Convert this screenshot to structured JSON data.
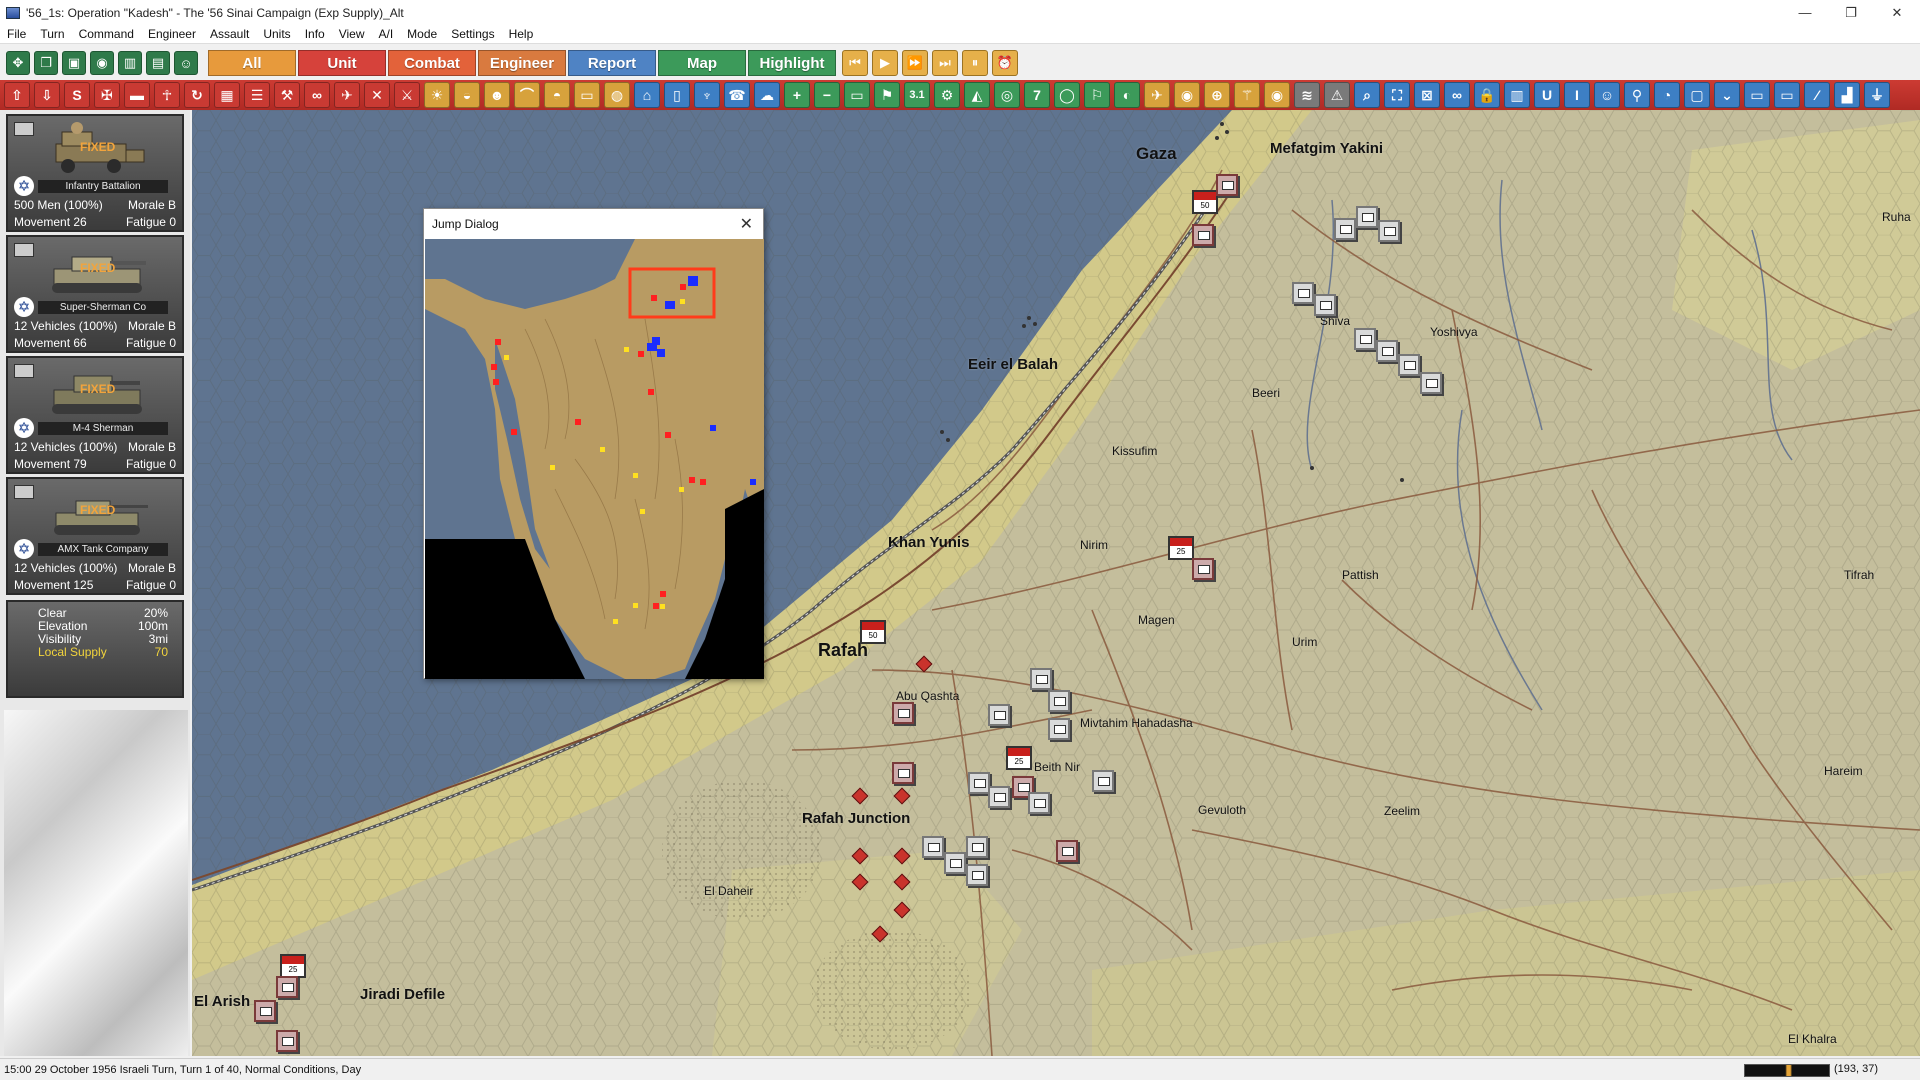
{
  "window": {
    "title": "'56_1s: Operation \"Kadesh\" - The '56 Sinai Campaign (Exp Supply)_Alt",
    "controls": [
      "—",
      "❐",
      "✕"
    ]
  },
  "menu": [
    "File",
    "Turn",
    "Command",
    "Engineer",
    "Assault",
    "Units",
    "Info",
    "View",
    "A/I",
    "Mode",
    "Settings",
    "Help"
  ],
  "toolbar": {
    "tabs": [
      {
        "label": "All",
        "color": "#e79a3c"
      },
      {
        "label": "Unit",
        "color": "#d6423b"
      },
      {
        "label": "Combat",
        "color": "#e3623a"
      },
      {
        "label": "Engineer",
        "color": "#d97a3f"
      },
      {
        "label": "Report",
        "color": "#4f83c4"
      },
      {
        "label": "Map",
        "color": "#3c9a5a"
      },
      {
        "label": "Highlight",
        "color": "#3c9a5a"
      }
    ],
    "row2_number_a": "3.1",
    "row2_number_b": "7"
  },
  "units": [
    {
      "name": "Infantry Battalion",
      "status": "FIXED",
      "strength": "500 Men (100%)",
      "morale": "Morale B",
      "movement": "Movement 26",
      "fatigue": "Fatigue 0"
    },
    {
      "name": "Super-Sherman Co",
      "status": "FIXED",
      "strength": "12 Vehicles (100%)",
      "morale": "Morale B",
      "movement": "Movement 66",
      "fatigue": "Fatigue 0"
    },
    {
      "name": "M-4 Sherman",
      "status": "FIXED",
      "strength": "12 Vehicles (100%)",
      "morale": "Morale B",
      "movement": "Movement 79",
      "fatigue": "Fatigue 0"
    },
    {
      "name": "AMX Tank Company",
      "status": "FIXED",
      "strength": "12 Vehicles (100%)",
      "morale": "Morale B",
      "movement": "Movement 125",
      "fatigue": "Fatigue 0"
    }
  ],
  "terrain": {
    "clear_label": "Clear",
    "clear_value": "20%",
    "elevation_label": "Elevation",
    "elevation_value": "100m",
    "visibility_label": "Visibility",
    "visibility_value": "3mi",
    "supply_label": "Local Supply",
    "supply_value": "70"
  },
  "places": {
    "gaza": "Gaza",
    "mefatgim": "Mefatgim Yakini",
    "ruha": "Ruha",
    "shiva": "Shiva",
    "yoshivya": "Yoshivya",
    "eeir": "Eeir el Balah",
    "beeri": "Beeri",
    "kissufim": "Kissufim",
    "khan_yunis": "Khan Yunis",
    "nirim": "Nirim",
    "pattish": "Pattish",
    "tifrah": "Tifrah",
    "magen": "Magen",
    "urim": "Urim",
    "rafah": "Rafah",
    "abu_qashta": "Abu Qashta",
    "mivtahim": "Mivtahim Hahadasha",
    "beith_nir": "Beith Nir",
    "hareim": "Hareim",
    "rafah_junction": "Rafah Junction",
    "gevuloth": "Gevuloth",
    "zeelim": "Zeelim",
    "el_daheir": "El Daheir",
    "el_arish": "El Arish",
    "jiradi": "Jiradi Defile",
    "el_khalra": "El Khalra"
  },
  "flags": {
    "gaza": "50",
    "rafah": "50",
    "rafah_jct": "25",
    "el_arish": "25",
    "khan_yunis": "25"
  },
  "jump_dialog": {
    "title": "Jump Dialog",
    "close": "✕"
  },
  "status": {
    "text": "15:00 29 October 1956 Israeli Turn, Turn 1 of 40, Normal Conditions, Day",
    "coords": "(193, 37)"
  },
  "colors": {
    "sea": "#5f7490",
    "beach": "#d2c98a",
    "land": "#c4be9c",
    "road": "#7a4a32",
    "toolbar_red": "#c0312b",
    "button_green": "#2f7a4a"
  }
}
